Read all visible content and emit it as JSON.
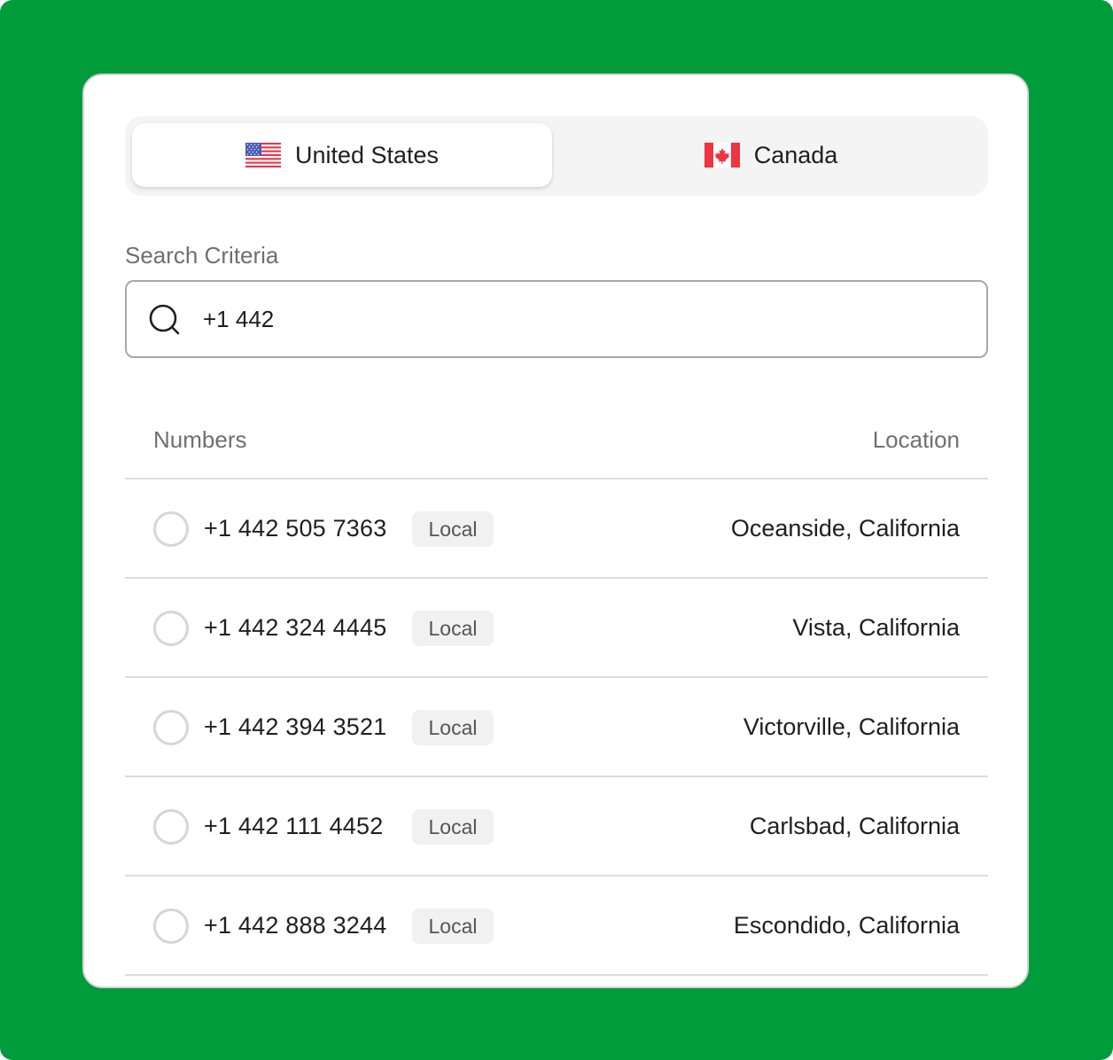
{
  "colors": {
    "background_green": "#009c3b",
    "card": "#ffffff",
    "segment_track": "#f4f4f4",
    "badge_bg": "#f1f1f1"
  },
  "country_tabs": [
    {
      "label": "United States",
      "flag": "us-flag-icon",
      "selected": true
    },
    {
      "label": "Canada",
      "flag": "canada-flag-icon",
      "selected": false
    }
  ],
  "search": {
    "label": "Search Criteria",
    "value": "+1 442",
    "icon": "search-icon"
  },
  "table": {
    "headers": {
      "numbers": "Numbers",
      "location": "Location"
    },
    "rows": [
      {
        "number": "+1 442 505 7363",
        "type": "Local",
        "location": "Oceanside, California",
        "selected": false
      },
      {
        "number": "+1 442 324 4445",
        "type": "Local",
        "location": "Vista, California",
        "selected": false
      },
      {
        "number": "+1 442 394 3521",
        "type": "Local",
        "location": "Victorville, California",
        "selected": false
      },
      {
        "number": "+1 442 111 4452",
        "type": "Local",
        "location": "Carlsbad, California",
        "selected": false
      },
      {
        "number": "+1 442 888 3244",
        "type": "Local",
        "location": "Escondido, California",
        "selected": false
      }
    ]
  }
}
